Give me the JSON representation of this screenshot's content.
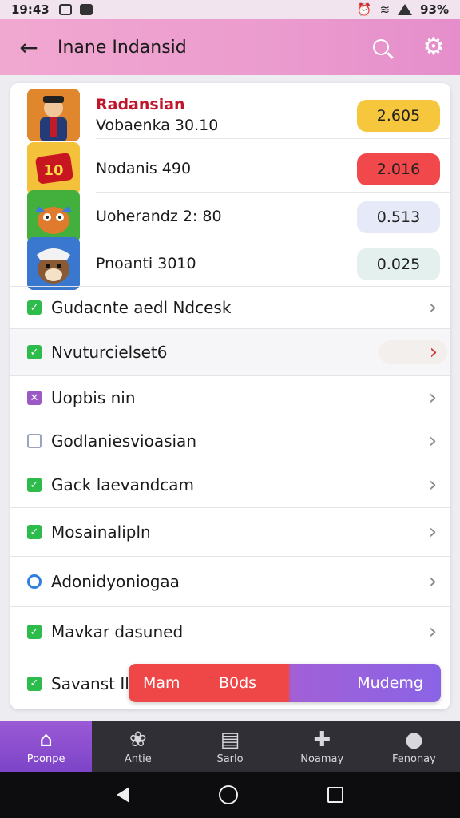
{
  "status_bar": {
    "time": "19:43",
    "battery": "93%"
  },
  "app_bar": {
    "title": "Inane Indansid"
  },
  "apps": [
    {
      "title": "Radansian",
      "subtitle": "Vobaenka 30.10",
      "score": "2.605",
      "pill_color": "#f6c73d"
    },
    {
      "title": "",
      "subtitle": "Nodanis 490",
      "score": "2.016",
      "pill_color": "#f1484c"
    },
    {
      "title": "",
      "subtitle": "Uoherandz 2: 80",
      "score": "0.513",
      "pill_color": "#e6e9f7"
    },
    {
      "title": "",
      "subtitle": "Pnoanti 3010",
      "score": "0.025",
      "pill_color": "#e4f0ee"
    }
  ],
  "list_items": [
    {
      "label": "Gudacnte aedl Ndcesk",
      "check": "green"
    },
    {
      "label": "Nvuturcielset6",
      "check": "green"
    },
    {
      "label": "Uopbis nin",
      "check": "purple"
    },
    {
      "label": "Godlaniesvioasian",
      "check": "grey"
    },
    {
      "label": "Gack laevandcam",
      "check": "green"
    },
    {
      "label": "Mosainalipln",
      "check": "green"
    },
    {
      "label": "Adonidyoniogaa",
      "check": "blue"
    },
    {
      "label": "Mavkar dasuned",
      "check": "green"
    },
    {
      "label": "Savanst Il",
      "check": "green"
    }
  ],
  "action_tray": {
    "left": "Mam",
    "middle": "B0ds",
    "right": "Mudemg"
  },
  "bottom_nav": [
    {
      "label": "Poonpe",
      "icon": "home-icon"
    },
    {
      "label": "Antie",
      "icon": "paw-icon"
    },
    {
      "label": "Sarlo",
      "icon": "clipboard-icon"
    },
    {
      "label": "Noamay",
      "icon": "puzzle-icon"
    },
    {
      "label": "Fenonay",
      "icon": "person-icon"
    }
  ]
}
